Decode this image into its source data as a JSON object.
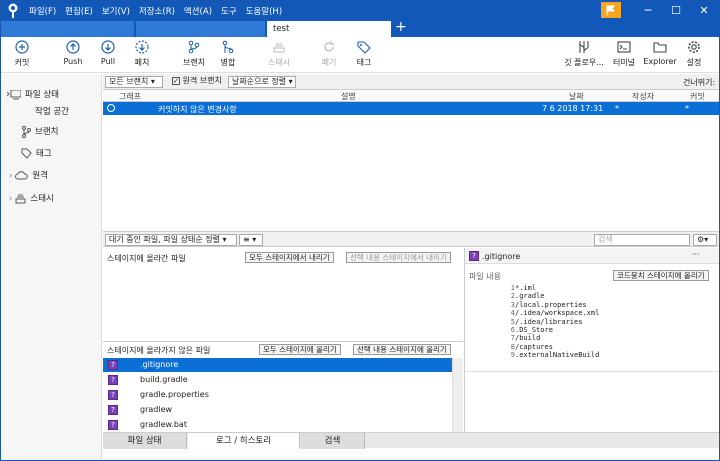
{
  "menu": [
    "파일(F)",
    "편집(E)",
    "보기(V)",
    "저장소(R)",
    "액션(A)",
    "도구",
    "도움말(H)"
  ],
  "tabs": {
    "active_label": "test",
    "add_label": "+"
  },
  "window": {
    "minimize": "─",
    "maximize": "☐",
    "close": "✕"
  },
  "toolbar": {
    "commit": "커밋",
    "push": "Push",
    "pull": "Pull",
    "fetch": "페치",
    "branch": "브랜치",
    "merge": "병합",
    "stash": "스태시",
    "discard": "폐기",
    "tag": "태그",
    "git_flow": "깃 플로우...",
    "terminal": "터미널",
    "explorer": "Explorer",
    "settings": "설정"
  },
  "sidebar": {
    "file_status": "파일 상태",
    "working_copy": "작업 공간",
    "branches": "브랜치",
    "tags": "태그",
    "remotes": "원격",
    "stashes": "스태시"
  },
  "filter": {
    "all_branches": "모든 브랜치",
    "remote_branches": "원격 브랜치",
    "sort": "날짜순으로 정렬",
    "jump_to": "건너뛰기:"
  },
  "history": {
    "columns": {
      "graph": "그래프",
      "description": "설명",
      "date": "날짜",
      "author": "작성자",
      "commit": "커밋"
    },
    "rows": [
      {
        "description": "커밋하지 않은 변경사항",
        "date": "7 6 2018 17:31",
        "author": "*",
        "commit": "*"
      }
    ]
  },
  "pending": {
    "sort_label": "대기 중인 파일, 파일 상태순 정렬",
    "search_placeholder": "검색",
    "staged_title": "스테이지에 올라간 파일",
    "unstage_all": "모두 스테이지에서 내리기",
    "unstage_selected": "선택 내용 스테이지에서 내리기",
    "unstaged_title": "스테이지에 올라가지 않은 파일",
    "stage_all": "모두 스테이지에 올리기",
    "stage_selected": "선택 내용 스테이지에 올리기",
    "files": [
      ".gitignore",
      "build.gradle",
      "gradle.properties",
      "gradlew",
      "gradlew.bat"
    ],
    "file_icon": "?"
  },
  "preview": {
    "filename": ".gitignore",
    "more": "···",
    "content_label": "파일 내용",
    "stage_hunk": "코드뭉치 스테이지에 올리기",
    "lines": [
      "*.iml",
      ".gradle",
      "/local.properties",
      "/.idea/workspace.xml",
      "/.idea/libraries",
      ".DS_Store",
      "/build",
      "/captures",
      ".externalNativeBuild"
    ]
  },
  "bottom_tabs": [
    "파일 상태",
    "로그 / 히스토리",
    "검색"
  ],
  "colors": {
    "accent": "#1258b8",
    "selection": "#0c6fd6",
    "flag": "#f5a623"
  }
}
